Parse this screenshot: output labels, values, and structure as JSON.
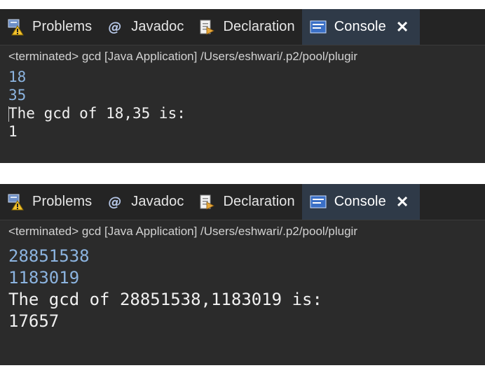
{
  "panels": [
    {
      "tabs": [
        {
          "label": "Problems",
          "icon": "problems-icon"
        },
        {
          "label": "Javadoc",
          "icon": "javadoc-at-icon"
        },
        {
          "label": "Declaration",
          "icon": "declaration-icon"
        },
        {
          "label": "Console",
          "icon": "console-icon",
          "active": true
        }
      ],
      "status": "<terminated> gcd [Java Application] /Users/eshwari/.p2/pool/plugir",
      "lines": [
        {
          "text": "18",
          "kind": "input"
        },
        {
          "text": "35",
          "kind": "input"
        },
        {
          "text": "The gcd of 18,35 is:",
          "kind": "output"
        },
        {
          "text": "1",
          "kind": "output"
        }
      ]
    },
    {
      "tabs": [
        {
          "label": "Problems",
          "icon": "problems-icon"
        },
        {
          "label": "Javadoc",
          "icon": "javadoc-at-icon"
        },
        {
          "label": "Declaration",
          "icon": "declaration-icon"
        },
        {
          "label": "Console",
          "icon": "console-icon",
          "active": true
        }
      ],
      "status": "<terminated> gcd [Java Application] /Users/eshwari/.p2/pool/plugir",
      "lines": [
        {
          "text": "28851538",
          "kind": "input"
        },
        {
          "text": "1183019",
          "kind": "input"
        },
        {
          "text": "The gcd of 28851538,1183019 is:",
          "kind": "output"
        },
        {
          "text": "17657",
          "kind": "output"
        }
      ]
    }
  ],
  "colors": {
    "panel_bg": "#2b2b2b",
    "tabbar_bg": "#242424",
    "active_tab_bg": "#2f3a48",
    "input_text": "#8cb4e0",
    "output_text": "#f0f0f0"
  }
}
